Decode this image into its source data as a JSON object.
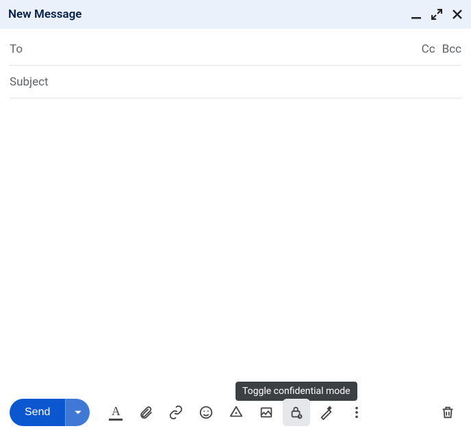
{
  "header": {
    "title": "New Message",
    "minimize_name": "minimize-icon",
    "expand_name": "expand-icon",
    "close_name": "close-icon"
  },
  "fields": {
    "to_placeholder": "To",
    "cc_label": "Cc",
    "bcc_label": "Bcc",
    "subject_placeholder": "Subject"
  },
  "tooltip": {
    "text": "Toggle confidential mode"
  },
  "toolbar": {
    "send_label": "Send",
    "icons": {
      "format": "format-icon",
      "attach": "attach-icon",
      "link": "link-icon",
      "emoji": "emoji-icon",
      "drive": "drive-icon",
      "image": "image-icon",
      "confidential": "confidential-mode-icon",
      "signature": "signature-icon",
      "more": "more-icon",
      "trash": "trash-icon"
    }
  }
}
